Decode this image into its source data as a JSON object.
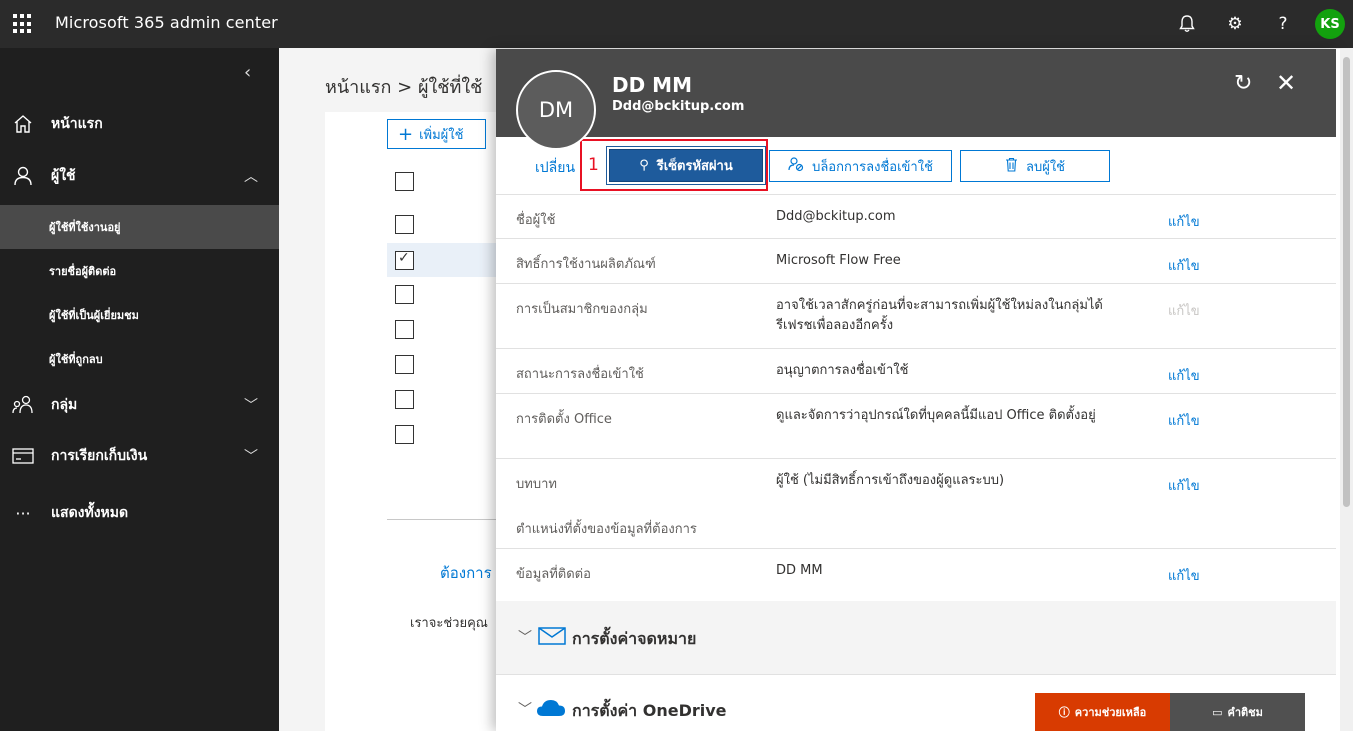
{
  "app": {
    "title": "Microsoft 365 admin center",
    "user_initials": "KS"
  },
  "leftnav": {
    "home": "หน้าแรก",
    "users": "ผู้ใช้",
    "sub_items": [
      "ผู้ใช้ที่ใช้งานอยู่",
      "รายชื่อผู้ติดต่อ",
      "ผู้ใช้ที่เป็นผู้เยี่ยมชม",
      "ผู้ใช้ที่ถูกลบ"
    ],
    "groups": "กลุ่ม",
    "billing": "การเรียกเก็บเงิน",
    "show_all": "แสดงทั้งหมด"
  },
  "main": {
    "breadcrumb": "หน้าแรก > ผู้ใช้ที่ใช้",
    "add_user": "เพิ่มผู้ใช้",
    "need_help": "ต้องการ",
    "help_text": "เราจะช่วยคุณ"
  },
  "panel": {
    "avatar_initials": "DM",
    "user_name": "DD MM",
    "user_email": "Ddd@bckitup.com",
    "switch_link": "เปลี่ยน",
    "annotation_number": "1",
    "actions": {
      "reset_password": "รีเซ็ตรหัสผ่าน",
      "block_signin": "บล็อกการลงชื่อเข้าใช้",
      "delete_user": "ลบผู้ใช้"
    },
    "properties": [
      {
        "label": "ชื่อผู้ใช้",
        "value": "Ddd@bckitup.com",
        "edit": "แก้ไข"
      },
      {
        "label": "สิทธิ์การใช้งานผลิตภัณฑ์",
        "value": "Microsoft Flow Free",
        "edit": "แก้ไข"
      },
      {
        "label": "การเป็นสมาชิกของกลุ่ม",
        "value": "อาจใช้เวลาสักครู่ก่อนที่จะสามารถเพิ่มผู้ใช้ใหม่ลงในกลุ่มได้ รีเฟรชเพื่อลองอีกครั้ง",
        "edit": "แก้ไข"
      },
      {
        "label": "สถานะการลงชื่อเข้าใช้",
        "value": "อนุญาตการลงชื่อเข้าใช้",
        "edit": "แก้ไข"
      },
      {
        "label": "การติดตั้ง Office",
        "value": "ดูและจัดการว่าอุปกรณ์ใดที่บุคคลนี้มีแอป Office ติดตั้งอยู่",
        "edit": "แก้ไข"
      },
      {
        "label": "บทบาท",
        "value": "ผู้ใช้ (ไม่มีสิทธิ์การเข้าถึงของผู้ดูแลระบบ)",
        "edit": "แก้ไข"
      },
      {
        "label": "ตำแหน่งที่ตั้งของข้อมูลที่ต้องการ",
        "value": "",
        "edit": ""
      },
      {
        "label": "ข้อมูลที่ติดต่อ",
        "value": "DD MM",
        "edit": "แก้ไข"
      }
    ],
    "sections": {
      "mail": "การตั้งค่าจดหมาย",
      "onedrive": "การตั้งค่า OneDrive"
    }
  },
  "floating": {
    "help": "ความช่วยเหลือ",
    "feedback": "คำติชม"
  },
  "colors": {
    "accent": "#0078d4",
    "topbar": "#2b2b2b",
    "nav": "#1f1f1f",
    "help": "#d83b01",
    "annotation": "#e81123"
  }
}
